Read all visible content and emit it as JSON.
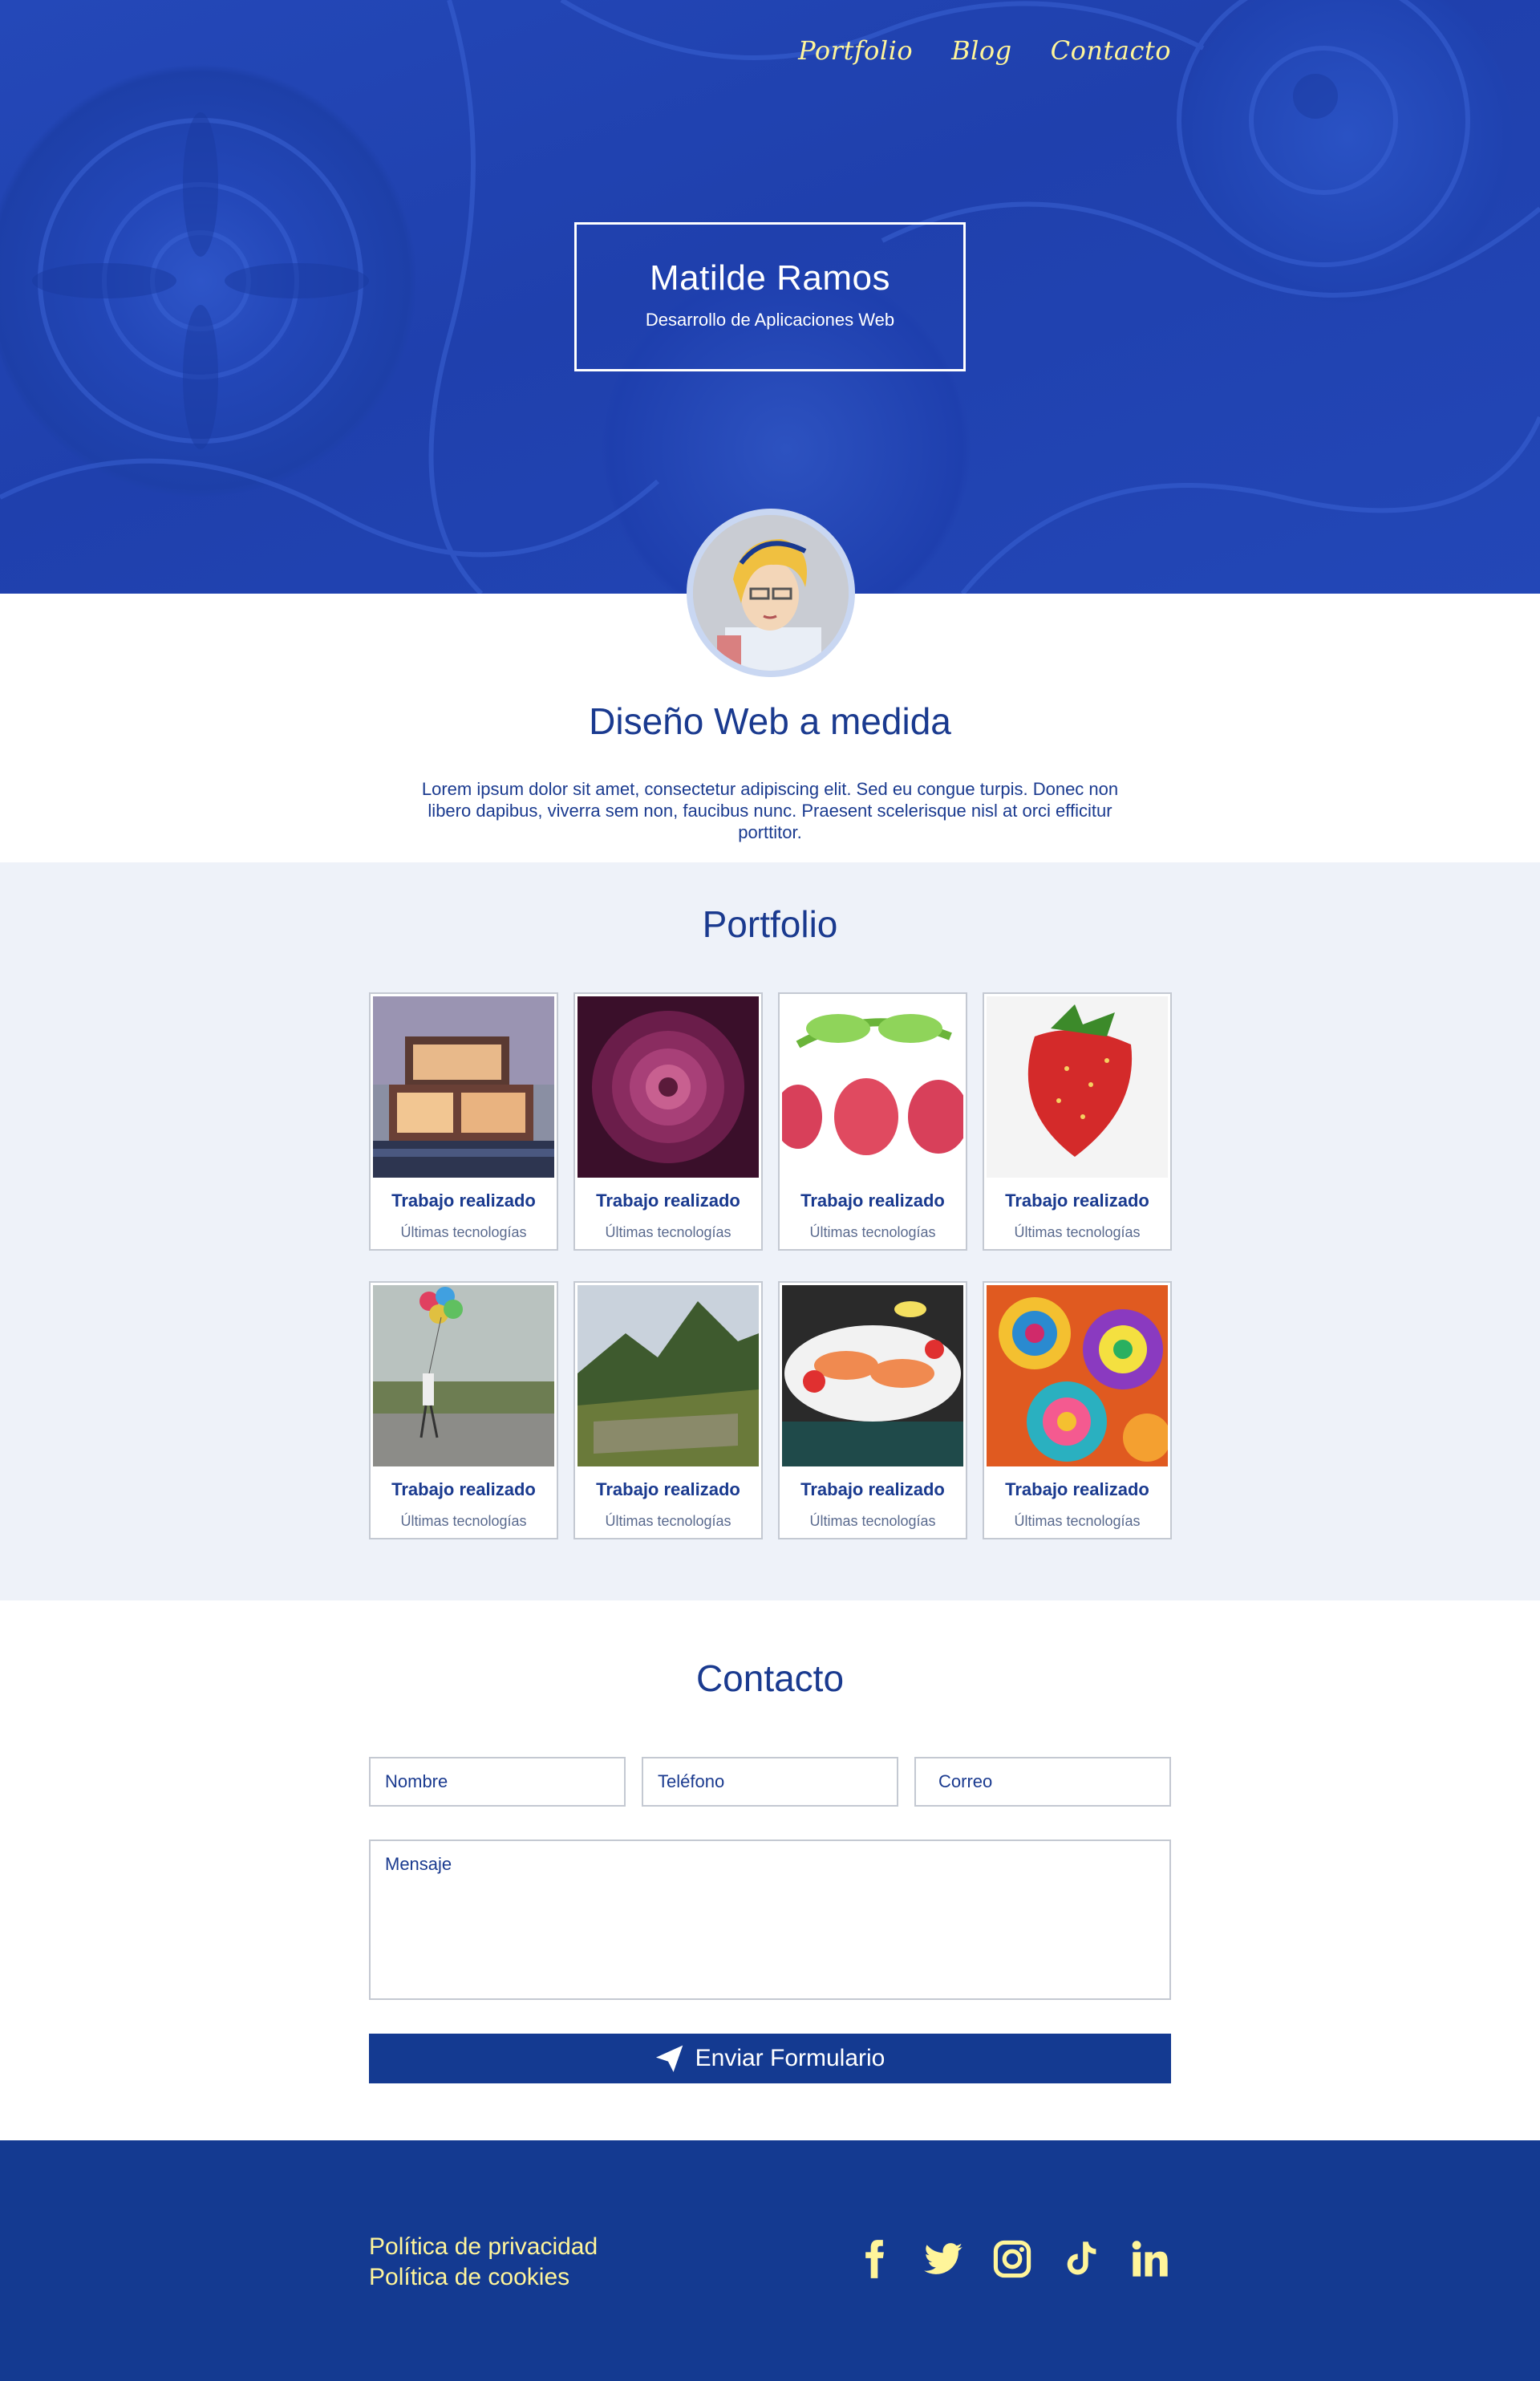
{
  "nav": {
    "items": [
      {
        "label": "Portfolio"
      },
      {
        "label": "Blog"
      },
      {
        "label": "Contacto"
      }
    ]
  },
  "hero": {
    "name": "Matilde Ramos",
    "tagline": "Desarrollo de Aplicaciones Web"
  },
  "intro": {
    "title": "Diseño Web a medida",
    "text": "Lorem ipsum dolor sit amet, consectetur adipiscing elit. Sed eu congue turpis. Donec non libero dapibus, viverra sem non, faucibus nunc. Praesent scelerisque nisl at orci efficitur porttitor."
  },
  "portfolio": {
    "title": "Portfolio",
    "items": [
      {
        "title": "Trabajo realizado",
        "subtitle": "Últimas tecnologías",
        "image": "modern-house"
      },
      {
        "title": "Trabajo realizado",
        "subtitle": "Últimas tecnologías",
        "image": "fractal-flower"
      },
      {
        "title": "Trabajo realizado",
        "subtitle": "Últimas tecnologías",
        "image": "raspberries"
      },
      {
        "title": "Trabajo realizado",
        "subtitle": "Últimas tecnologías",
        "image": "strawberry"
      },
      {
        "title": "Trabajo realizado",
        "subtitle": "Últimas tecnologías",
        "image": "girl-with-balloons"
      },
      {
        "title": "Trabajo realizado",
        "subtitle": "Últimas tecnologías",
        "image": "machu-picchu"
      },
      {
        "title": "Trabajo realizado",
        "subtitle": "Últimas tecnologías",
        "image": "salmon-dish"
      },
      {
        "title": "Trabajo realizado",
        "subtitle": "Últimas tecnologías",
        "image": "mandala-pattern"
      }
    ]
  },
  "contact": {
    "title": "Contacto",
    "name_placeholder": "Nombre",
    "phone_placeholder": "Teléfono",
    "email_placeholder": "Correo",
    "message_placeholder": "Mensaje",
    "submit_label": "Enviar Formulario"
  },
  "footer": {
    "privacy": "Política de privacidad",
    "cookies": "Política de cookies",
    "social": [
      "facebook-icon",
      "twitter-icon",
      "instagram-icon",
      "tiktok-icon",
      "linkedin-icon"
    ]
  },
  "colors": {
    "primary": "#143a91",
    "accent": "#fff59a",
    "hero_blue": "#2347b8",
    "section_bg": "#eef2f9"
  }
}
